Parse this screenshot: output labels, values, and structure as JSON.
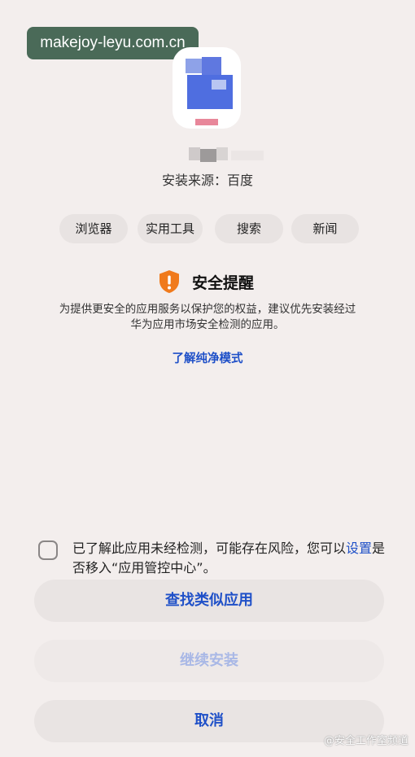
{
  "watermark_url": "makejoy-leyu.com.cn",
  "app": {
    "icon": "app-icon-pixelated",
    "source_text": "安装来源：百度"
  },
  "tags": [
    "浏览器",
    "实用工具",
    "搜索",
    "新闻"
  ],
  "alert": {
    "icon": "shield-warning-icon",
    "title": "安全提醒",
    "desc_line1": "为提供更安全的应用服务以保护您的权益，建议优先安装经过",
    "desc_line2": "华为应用市场安全检测的应用。",
    "link": "了解纯净模式"
  },
  "consent": {
    "text_before": "已了解此应用未经检测，可能存在风险，您可以",
    "link": "设置",
    "text_after": "是否移入“应用管控中心”。"
  },
  "buttons": {
    "find_similar": "查找类似应用",
    "continue_install": "继续安装",
    "cancel": "取消"
  },
  "corner_watermark": "@安全工作室频道",
  "colors": {
    "accent": "#1f50c8",
    "warning": "#f07a1c",
    "background": "#f3eeed"
  }
}
